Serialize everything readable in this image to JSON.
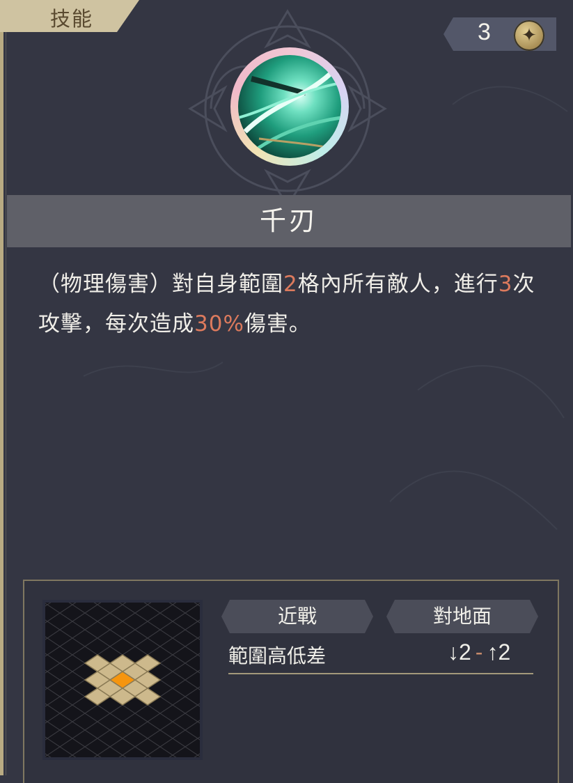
{
  "tab": {
    "label": "技能"
  },
  "counter": {
    "value": "3",
    "icon": "star-coin-icon"
  },
  "skill": {
    "icon": "sword-slash-icon",
    "name": "千刃",
    "description": {
      "p1": "（物理傷害）對自身範圍",
      "v1": "2",
      "p2": "格內所有敵人，進行",
      "v2": "3",
      "p3": "次攻擊，每次造成",
      "v3": "30%",
      "p4": "傷害。"
    }
  },
  "info": {
    "tags": {
      "melee": "近戰",
      "target": "對地面"
    },
    "stat": {
      "label": "範圍高低差",
      "down_value": "2",
      "separator": "-",
      "up_value": "2"
    }
  },
  "range_grid": {
    "cells": [
      [
        0,
        -1
      ],
      [
        -1,
        -1
      ],
      [
        1,
        -1
      ],
      [
        -1,
        0
      ],
      [
        1,
        0
      ],
      [
        0,
        1
      ],
      [
        -1,
        1
      ],
      [
        1,
        1
      ],
      [
        0,
        -2
      ],
      [
        0,
        2
      ],
      [
        -2,
        0
      ],
      [
        2,
        0
      ]
    ],
    "center": [
      0,
      0
    ]
  },
  "colors": {
    "background": "#343643",
    "accent_frame": "#b9ab83",
    "highlight": "#dc7a5d",
    "grid_tile": "#cdb98c",
    "grid_center": "#f5950f"
  }
}
